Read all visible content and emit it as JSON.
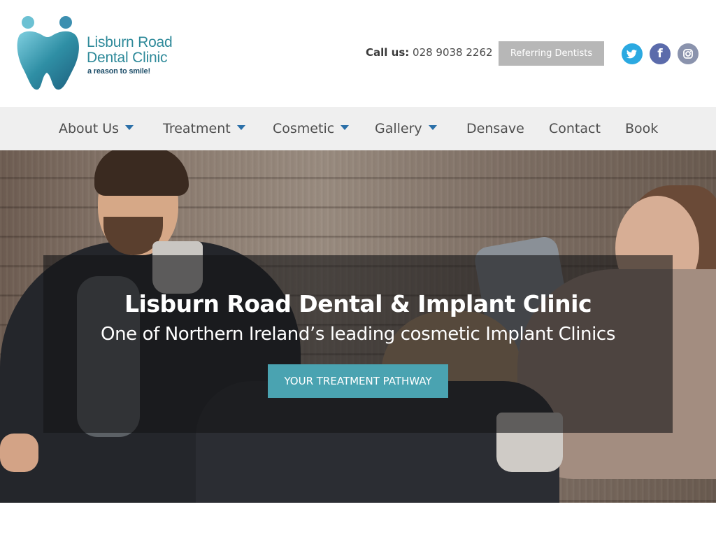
{
  "brand": {
    "name_line1": "Lisburn Road",
    "name_line2": "Dental Clinic",
    "tagline": "a reason to smile!",
    "color": "#2f8a9a"
  },
  "header": {
    "call_label": "Call us:",
    "phone": "028 9038 2262",
    "referring_button": "Referring Dentists",
    "social": [
      {
        "name": "twitter-icon",
        "color": "#2ba9e1"
      },
      {
        "name": "facebook-icon",
        "color": "#5b6bab"
      },
      {
        "name": "instagram-icon",
        "color": "#8a93ad"
      }
    ]
  },
  "nav": {
    "items": [
      {
        "label": "About Us",
        "dropdown": true
      },
      {
        "label": "Treatment",
        "dropdown": true
      },
      {
        "label": "Cosmetic",
        "dropdown": true
      },
      {
        "label": "Gallery",
        "dropdown": true
      },
      {
        "label": "Densave",
        "dropdown": false
      },
      {
        "label": "Contact",
        "dropdown": false
      },
      {
        "label": "Book",
        "dropdown": false
      }
    ],
    "caret_color": "#2a6fa8"
  },
  "hero": {
    "title": "Lisburn Road Dental & Implant Clinic",
    "subtitle": "One of Northern Ireland’s leading cosmetic Implant Clinics",
    "cta": "YOUR TREATMENT PATHWAY",
    "cta_color": "#4aa3b1"
  }
}
